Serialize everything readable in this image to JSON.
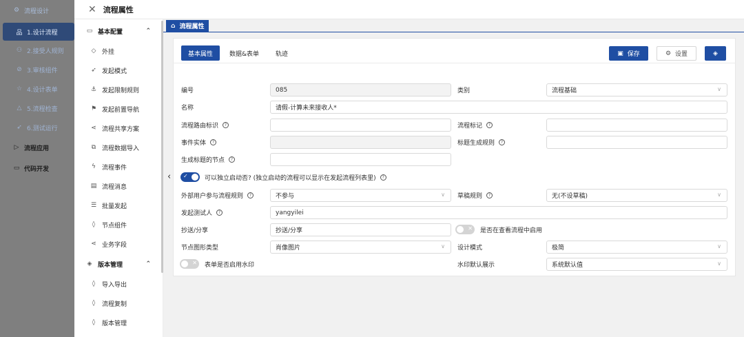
{
  "app_nav": {
    "title": "流程设计",
    "items": [
      {
        "label": "1.设计流程"
      },
      {
        "label": "2.接受人规则"
      },
      {
        "label": "3.审核组件"
      },
      {
        "label": "4.设计表单"
      },
      {
        "label": "5.流程检查"
      },
      {
        "label": "6.测试运行"
      },
      {
        "label": "流程应用"
      },
      {
        "label": "代码开发"
      }
    ]
  },
  "drawer": {
    "title": "流程属性"
  },
  "config": {
    "group_basic": "基本配置",
    "basic_items": [
      {
        "label": "外挂"
      },
      {
        "label": "发起模式"
      },
      {
        "label": "发起限制规则"
      },
      {
        "label": "发起前置导航"
      },
      {
        "label": "流程共享方案"
      },
      {
        "label": "流程数据导入"
      },
      {
        "label": "流程事件"
      },
      {
        "label": "流程消息"
      },
      {
        "label": "批量发起"
      },
      {
        "label": "节点组件"
      },
      {
        "label": "业务字段"
      }
    ],
    "group_version": "版本管理",
    "version_items": [
      {
        "label": "导入导出"
      },
      {
        "label": "流程复制"
      },
      {
        "label": "版本管理"
      }
    ]
  },
  "breadcrumb": {
    "label": "流程属性"
  },
  "tabs": [
    {
      "label": "基本属性"
    },
    {
      "label": "数据&表单"
    },
    {
      "label": "轨迹"
    }
  ],
  "actions": {
    "save": "保存",
    "settings": "设置"
  },
  "form": {
    "no_label": "编号",
    "no_value": "085",
    "category_label": "类别",
    "category_value": "流程基础",
    "name_label": "名称",
    "name_value": "请假-计算未来接收人*",
    "route_label": "流程路由标识",
    "route_value": "",
    "flowmark_label": "流程标记",
    "flowmark_value": "",
    "entity_label": "事件实体",
    "entity_value": "",
    "titlerule_label": "标题生成规则",
    "titlerule_value": "",
    "titlenode_label": "生成标题的节点",
    "titlenode_value": "",
    "standalone_label": "可以独立启动否? (独立启动的流程可以显示在发起流程列表里)",
    "external_label": "外部用户参与流程规则",
    "external_value": "不参与",
    "draft_label": "草稿规则",
    "draft_value": "无(不设草稿)",
    "tester_label": "发起测试人",
    "tester_value": "yangyilei",
    "cc_label": "抄送/分享",
    "cc_value": "抄送/分享",
    "cc_enable_label": "是否在查看流程中启用",
    "shape_label": "节点图形类型",
    "shape_value": "肖像图片",
    "mode_label": "设计模式",
    "mode_value": "极简",
    "watermark_label": "表单是否启用水印",
    "wm_display_label": "水印默认展示",
    "wm_display_value": "系统默认值"
  },
  "colors": {
    "primary": "#1f4ea3",
    "nav_bg": "#7f7f7f"
  }
}
